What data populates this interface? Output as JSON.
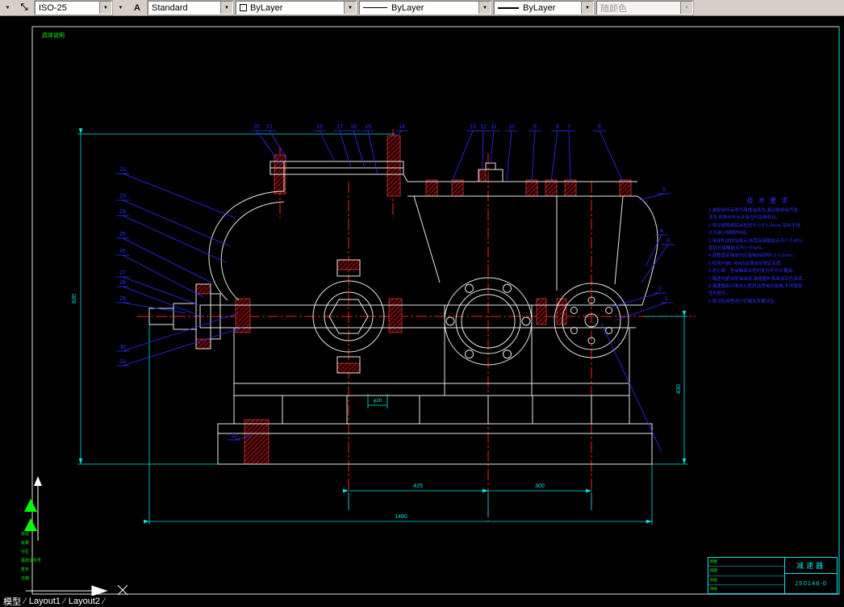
{
  "toolbar": {
    "icons": {
      "flyout": "▼",
      "combo_arrow": "▼",
      "dim_style": "⤡",
      "text_style": "A"
    },
    "dim_style": {
      "value": "ISO-25"
    },
    "text_style": {
      "value": "Standard"
    },
    "color_control": {
      "value": "ByLayer",
      "swatch_color": "#ffffff"
    },
    "linetype_control": {
      "value": "ByLayer"
    },
    "lineweight_control": {
      "value": "ByLayer"
    },
    "plot_style_control": {
      "value": "随颜色"
    }
  },
  "tabs": {
    "items": [
      "模型",
      "Layout1",
      "Layout2"
    ],
    "separator": "∕"
  },
  "drawing": {
    "sheet_note": "具体说明",
    "frame_rows": [
      "标记",
      "处数",
      "分区",
      "更改文件号",
      "签字",
      "日期"
    ],
    "notes": {
      "title": "技 术 要 求",
      "lines": [
        "1.装配前所有零件用煤油清洗,滚动轴承用汽油",
        "  清洗,机体内不允许有任何杂物存在。",
        "2.啮合侧隙用铅丝检验不小于0.16mm,铅丝不得",
        "  大于最小侧隙的4倍。",
        "3.用涂色法检验斑点:按齿高接触斑点不少于40%,",
        "  按齿长接触斑点不少于50%。",
        "4.调整固定轴承时应留轴向间隙0.2~0.5mm。",
        "5.机座内装L-AN68润滑油至规定高度。",
        "6.剖分面、各接触面及密封处均不允许漏油。",
        "7.箱座内壁涂耐油油漆,减速器外表面涂灰色油漆。",
        "8.减速器剖分面涂以密封油漆或水玻璃,不得使用",
        "  任何垫片。",
        "9.按试验规程进行空载及负载试验。"
      ]
    },
    "callouts": [
      "20",
      "21",
      "19",
      "17",
      "16",
      "15",
      "14",
      "13",
      "12",
      "11",
      "10",
      "9",
      "8",
      "7",
      "6",
      "5",
      "4",
      "3",
      "2",
      "1",
      "22",
      "23",
      "24",
      "25",
      "26",
      "27",
      "28",
      "29",
      "30",
      "31",
      "32"
    ],
    "dims": {
      "span_left": "425",
      "span_right": "300",
      "total": "1460",
      "height": "630",
      "right_height": "430",
      "bore": "φ20"
    },
    "title_block": {
      "product": "减速器",
      "drawing_no": "JS0146-0",
      "rows": [
        "制图",
        "描图",
        "校核",
        "审核"
      ]
    },
    "colors": {
      "line": "#e8e8e8",
      "dim": "#00e5e5",
      "center": "#ff2020",
      "callout": "#2f2fff",
      "sheet": "#00ff00"
    }
  }
}
